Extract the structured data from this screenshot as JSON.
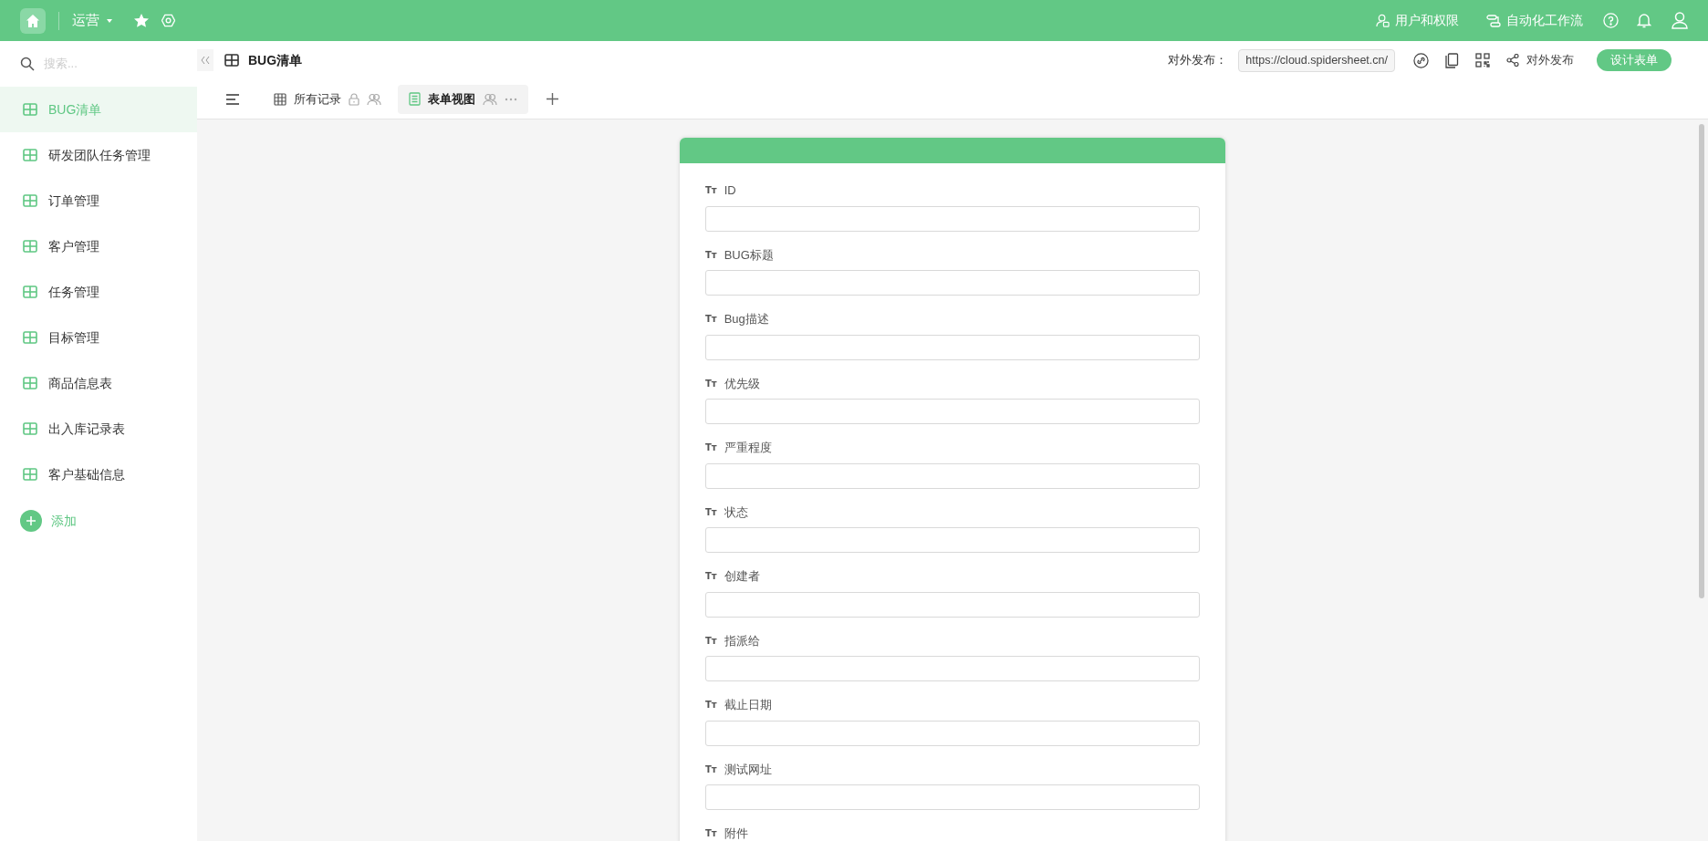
{
  "topbar": {
    "workspace": "运营",
    "links": [
      {
        "kind": "users",
        "label": "用户和权限"
      },
      {
        "kind": "flow",
        "label": "自动化工作流"
      }
    ]
  },
  "sidebar": {
    "search": {
      "placeholder": "搜索..."
    },
    "items": [
      {
        "label": "BUG清单",
        "selected": true
      },
      {
        "label": "研发团队任务管理",
        "selected": false
      },
      {
        "label": "订单管理",
        "selected": false
      },
      {
        "label": "客户管理",
        "selected": false
      },
      {
        "label": "任务管理",
        "selected": false
      },
      {
        "label": "目标管理",
        "selected": false
      },
      {
        "label": "商品信息表",
        "selected": false
      },
      {
        "label": "出入库记录表",
        "selected": false
      },
      {
        "label": "客户基础信息",
        "selected": false
      }
    ],
    "add_label": "添加"
  },
  "header": {
    "title": "BUG清单",
    "publish_label": "对外发布：",
    "url": "https://cloud.spidersheet.cn/",
    "share_label": "对外发布",
    "design_button": "设计表单"
  },
  "tabs": [
    {
      "kind": "grid",
      "label": "所有记录",
      "locked": true,
      "selected": false
    },
    {
      "kind": "form",
      "label": "表单视图",
      "locked": false,
      "selected": true
    }
  ],
  "form": {
    "fields": [
      {
        "type_icon": "Tт",
        "label": "ID"
      },
      {
        "type_icon": "Tт",
        "label": "BUG标题"
      },
      {
        "type_icon": "Tт",
        "label": "Bug描述"
      },
      {
        "type_icon": "Tт",
        "label": "优先级"
      },
      {
        "type_icon": "Tт",
        "label": "严重程度"
      },
      {
        "type_icon": "Tт",
        "label": "状态"
      },
      {
        "type_icon": "Tт",
        "label": "创建者"
      },
      {
        "type_icon": "Tт",
        "label": "指派给"
      },
      {
        "type_icon": "Tт",
        "label": "截止日期"
      },
      {
        "type_icon": "Tт",
        "label": "测试网址"
      },
      {
        "type_icon": "Tт",
        "label": "附件"
      }
    ]
  }
}
